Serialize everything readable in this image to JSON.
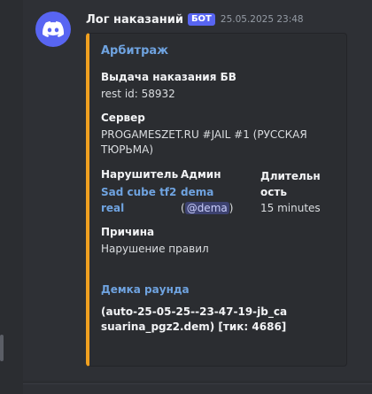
{
  "message": {
    "author": "Лог наказаний",
    "badge": "БОТ",
    "timestamp": "25.05.2025 23:48",
    "avatar_icon": "discord-logo-icon",
    "avatar_color": "#5865f2"
  },
  "embed": {
    "accent_color": "#f0a020",
    "title": "Арбитраж",
    "fields": {
      "punishment_name": "Выдача наказания БВ",
      "punishment_value": "rest id: 58932",
      "server_name": "Сервер",
      "server_value": "PROGAMESZET.RU #JAIL #1 (РУССКАЯ ТЮРЬМА)",
      "violator_name": "Нарушитель",
      "violator_value": "Sad cube tf2 real",
      "admin_name": "Админ",
      "admin_link": "dema",
      "admin_mention": "@dema",
      "admin_paren_open": "(",
      "admin_paren_close": ")",
      "duration_name": "Длительность",
      "duration_value": "15 minutes",
      "reason_name": "Причина",
      "reason_value": "Нарушение правил",
      "demo_title": "Демка раунда",
      "demo_value": "(auto-25-05-25--23-47-19-jb_casuarina_pgz2.dem) [тик: 4686]"
    }
  }
}
